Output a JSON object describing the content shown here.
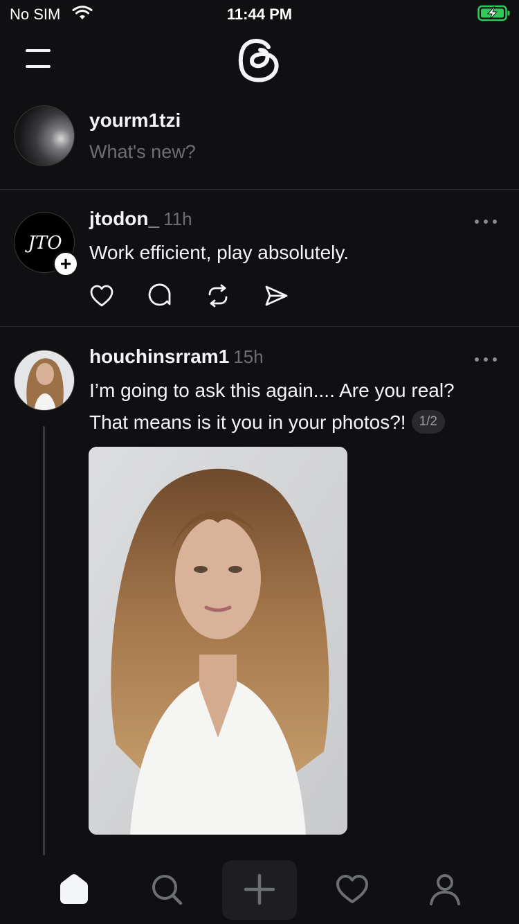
{
  "status_bar": {
    "carrier": "No SIM",
    "time": "11:44 PM",
    "battery_color": "#34c759"
  },
  "header": {
    "menu_icon": "menu-icon",
    "logo_icon": "threads-logo-icon"
  },
  "composer": {
    "username": "yourm1tzi",
    "prompt": "What's new?"
  },
  "posts": [
    {
      "username": "jtodon_",
      "time": "11h",
      "avatar_monogram": "JTO",
      "text": "Work efficient, play absolutely.",
      "actions": [
        "heart-icon",
        "comment-icon",
        "repost-icon",
        "share-icon"
      ]
    },
    {
      "username": "houchinsrram1",
      "time": "15h",
      "text_line1": "I’m going to ask this again.... Are you real?",
      "text_line2": "That means is it you in your photos?!",
      "image_counter": "1/2"
    }
  ],
  "tab_bar": {
    "items": [
      "home-icon",
      "search-icon",
      "compose-icon",
      "activity-heart-icon",
      "profile-icon"
    ],
    "active": "home-icon"
  }
}
